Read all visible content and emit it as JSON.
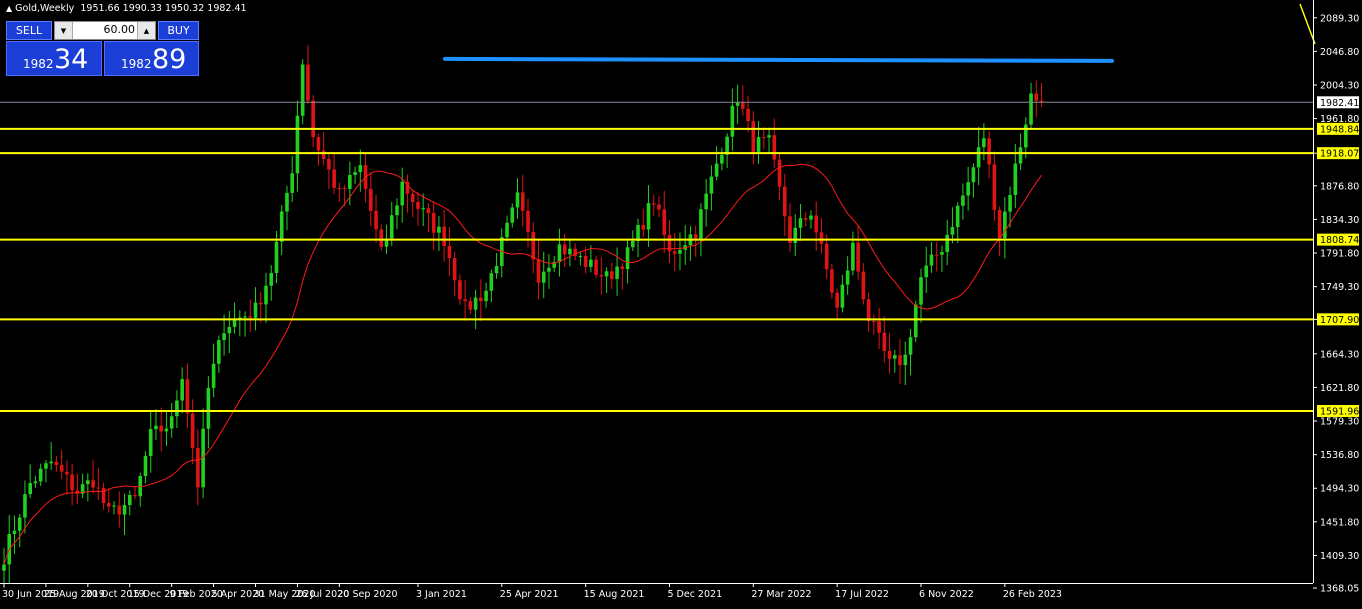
{
  "title": {
    "symbol": "Gold,Weekly",
    "ohlc": "1951.66 1990.33 1950.32 1982.41"
  },
  "trade_panel": {
    "sell_label": "SELL",
    "buy_label": "BUY",
    "lot": "60.00",
    "sell_price_prefix": "1982",
    "sell_price_big": "34",
    "buy_price_prefix": "1982",
    "buy_price_big": "89"
  },
  "colors": {
    "background": "#000000",
    "bull": "#22d022",
    "bear": "#e01414",
    "ma": "#ff1a1a",
    "level": "#ffff00",
    "resistance": "#1e90ff",
    "axis": "#ffffff"
  },
  "icons": {
    "lot_down": "triangle-down-icon",
    "lot_up": "triangle-up-icon",
    "title_marker": "triangle-up-icon"
  },
  "chart_data": {
    "type": "candlestick",
    "symbol": "Gold",
    "timeframe": "Weekly",
    "ylim": [
      1368.05,
      2100
    ],
    "y_ticks": [
      "2089.30",
      "2046.80",
      "2004.30",
      "1961.80",
      "1918.07",
      "1876.80",
      "1834.30",
      "1791.80",
      "1749.30",
      "1707.90",
      "1664.30",
      "1621.80",
      "1579.30",
      "1536.80",
      "1494.30",
      "1451.80",
      "1409.30",
      "1368.05"
    ],
    "x_tick_labels": [
      "30 Jun 2019",
      "25 Aug 2019",
      "20 Oct 2019",
      "15 Dec 2019",
      "9 Feb 2020",
      "5 Apr 2020",
      "31 May 2020",
      "26 Jul 2020",
      "20 Sep 2020",
      "3 Jan 2021",
      "25 Apr 2021",
      "15 Aug 2021",
      "5 Dec 2021",
      "27 Mar 2022",
      "17 Jul 2022",
      "6 Nov 2022",
      "26 Feb 2023"
    ],
    "current_price": "1982.41",
    "horizontal_levels": [
      "1948.84",
      "1918.07",
      "1808.74",
      "1707.90",
      "1591.96"
    ],
    "resistance_line": 2036,
    "close_path": [
      [
        "30 Jun 2019",
        1409
      ],
      [
        "4 Aug 2019",
        1500
      ],
      [
        "1 Sep 2019",
        1527
      ],
      [
        "6 Oct 2019",
        1490
      ],
      [
        "27 Oct 2019",
        1505
      ],
      [
        "17 Nov 2019",
        1462
      ],
      [
        "22 Dec 2019",
        1480
      ],
      [
        "12 Jan 2020",
        1560
      ],
      [
        "9 Feb 2020",
        1578
      ],
      [
        "23 Feb 2020",
        1640
      ],
      [
        "15 Mar 2020",
        1500
      ],
      [
        "29 Mar 2020",
        1620
      ],
      [
        "19 Apr 2020",
        1700
      ],
      [
        "31 May 2020",
        1720
      ],
      [
        "21 Jun 2020",
        1770
      ],
      [
        "19 Jul 2020",
        1900
      ],
      [
        "2 Aug 2020",
        2035
      ],
      [
        "16 Aug 2020",
        1940
      ],
      [
        "20 Sep 2020",
        1865
      ],
      [
        "18 Oct 2020",
        1900
      ],
      [
        "15 Nov 2020",
        1790
      ],
      [
        "13 Dec 2020",
        1880
      ],
      [
        "3 Jan 2021",
        1850
      ],
      [
        "7 Feb 2021",
        1810
      ],
      [
        "7 Mar 2021",
        1720
      ],
      [
        "4 Apr 2021",
        1745
      ],
      [
        "16 May 2021",
        1860
      ],
      [
        "13 Jun 2021",
        1765
      ],
      [
        "11 Jul 2021",
        1800
      ],
      [
        "15 Aug 2021",
        1780
      ],
      [
        "12 Sep 2021",
        1760
      ],
      [
        "10 Oct 2021",
        1790
      ],
      [
        "14 Nov 2021",
        1860
      ],
      [
        "5 Dec 2021",
        1790
      ],
      [
        "9 Jan 2022",
        1820
      ],
      [
        "6 Mar 2022",
        1990
      ],
      [
        "27 Mar 2022",
        1930
      ],
      [
        "17 Apr 2022",
        1930
      ],
      [
        "15 May 2022",
        1810
      ],
      [
        "12 Jun 2022",
        1845
      ],
      [
        "17 Jul 2022",
        1720
      ],
      [
        "7 Aug 2022",
        1800
      ],
      [
        "28 Aug 2022",
        1710
      ],
      [
        "25 Sep 2022",
        1650
      ],
      [
        "16 Oct 2022",
        1660
      ],
      [
        "6 Nov 2022",
        1760
      ],
      [
        "4 Dec 2022",
        1800
      ],
      [
        "8 Jan 2023",
        1880
      ],
      [
        "29 Jan 2023",
        1940
      ],
      [
        "19 Feb 2023",
        1815
      ],
      [
        "12 Mar 2023",
        1900
      ],
      [
        "2 Apr 2023",
        1990
      ],
      [
        "16 Apr 2023",
        1982
      ]
    ]
  }
}
